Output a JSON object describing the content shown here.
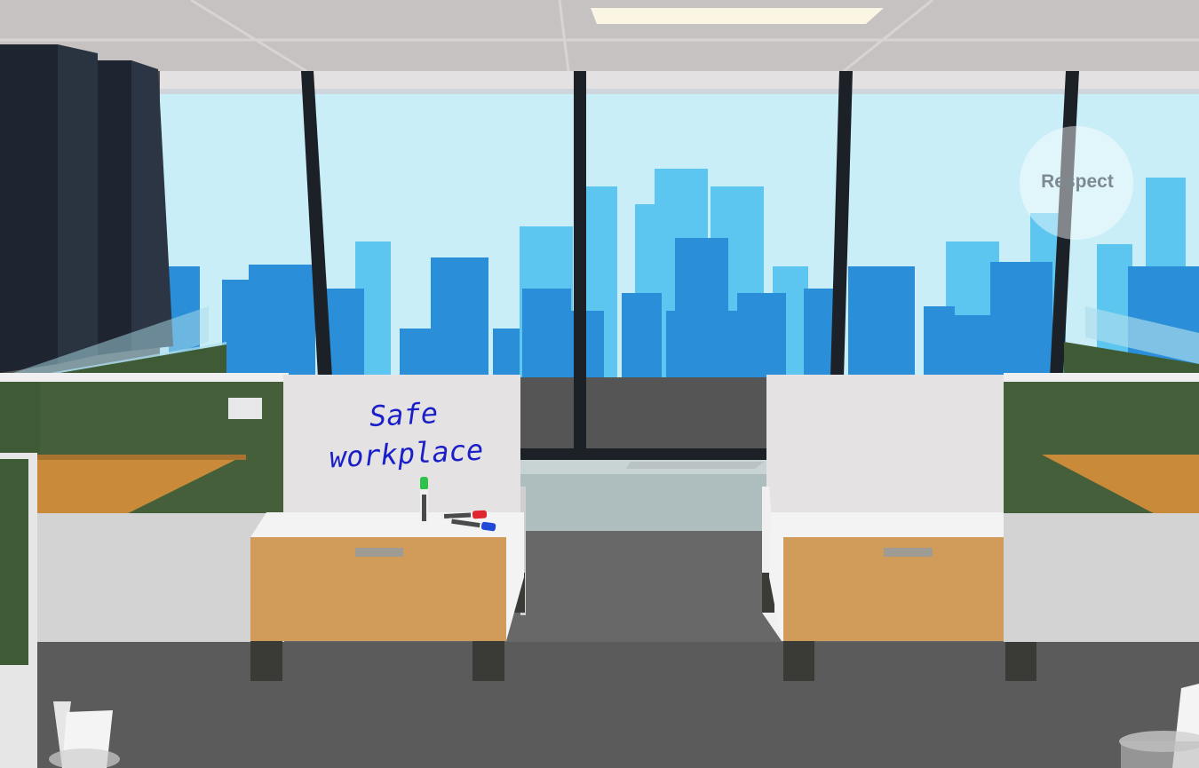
{
  "scene": {
    "whiteboard_line1": "Safe",
    "whiteboard_line2": "workplace",
    "bubble_label": "Respect",
    "colors": {
      "sky": "#c9eef7",
      "building_light": "#5cc6f0",
      "building_dark": "#2a8fd8",
      "partition_green": "#3f5b35",
      "desk_top": "#c98a3a",
      "drawer": "#d19c5a",
      "carpet": "#5b5b5b",
      "ceiling": "#c6c2c1",
      "marker_green": "#2fc14a",
      "marker_red": "#e0262e",
      "marker_blue": "#1f49d6",
      "whiteboard_ink": "#1a1fc8"
    },
    "icons": [
      "ceiling-light-icon",
      "marker-icon",
      "wastebasket-icon",
      "pinned-note-icon"
    ]
  }
}
